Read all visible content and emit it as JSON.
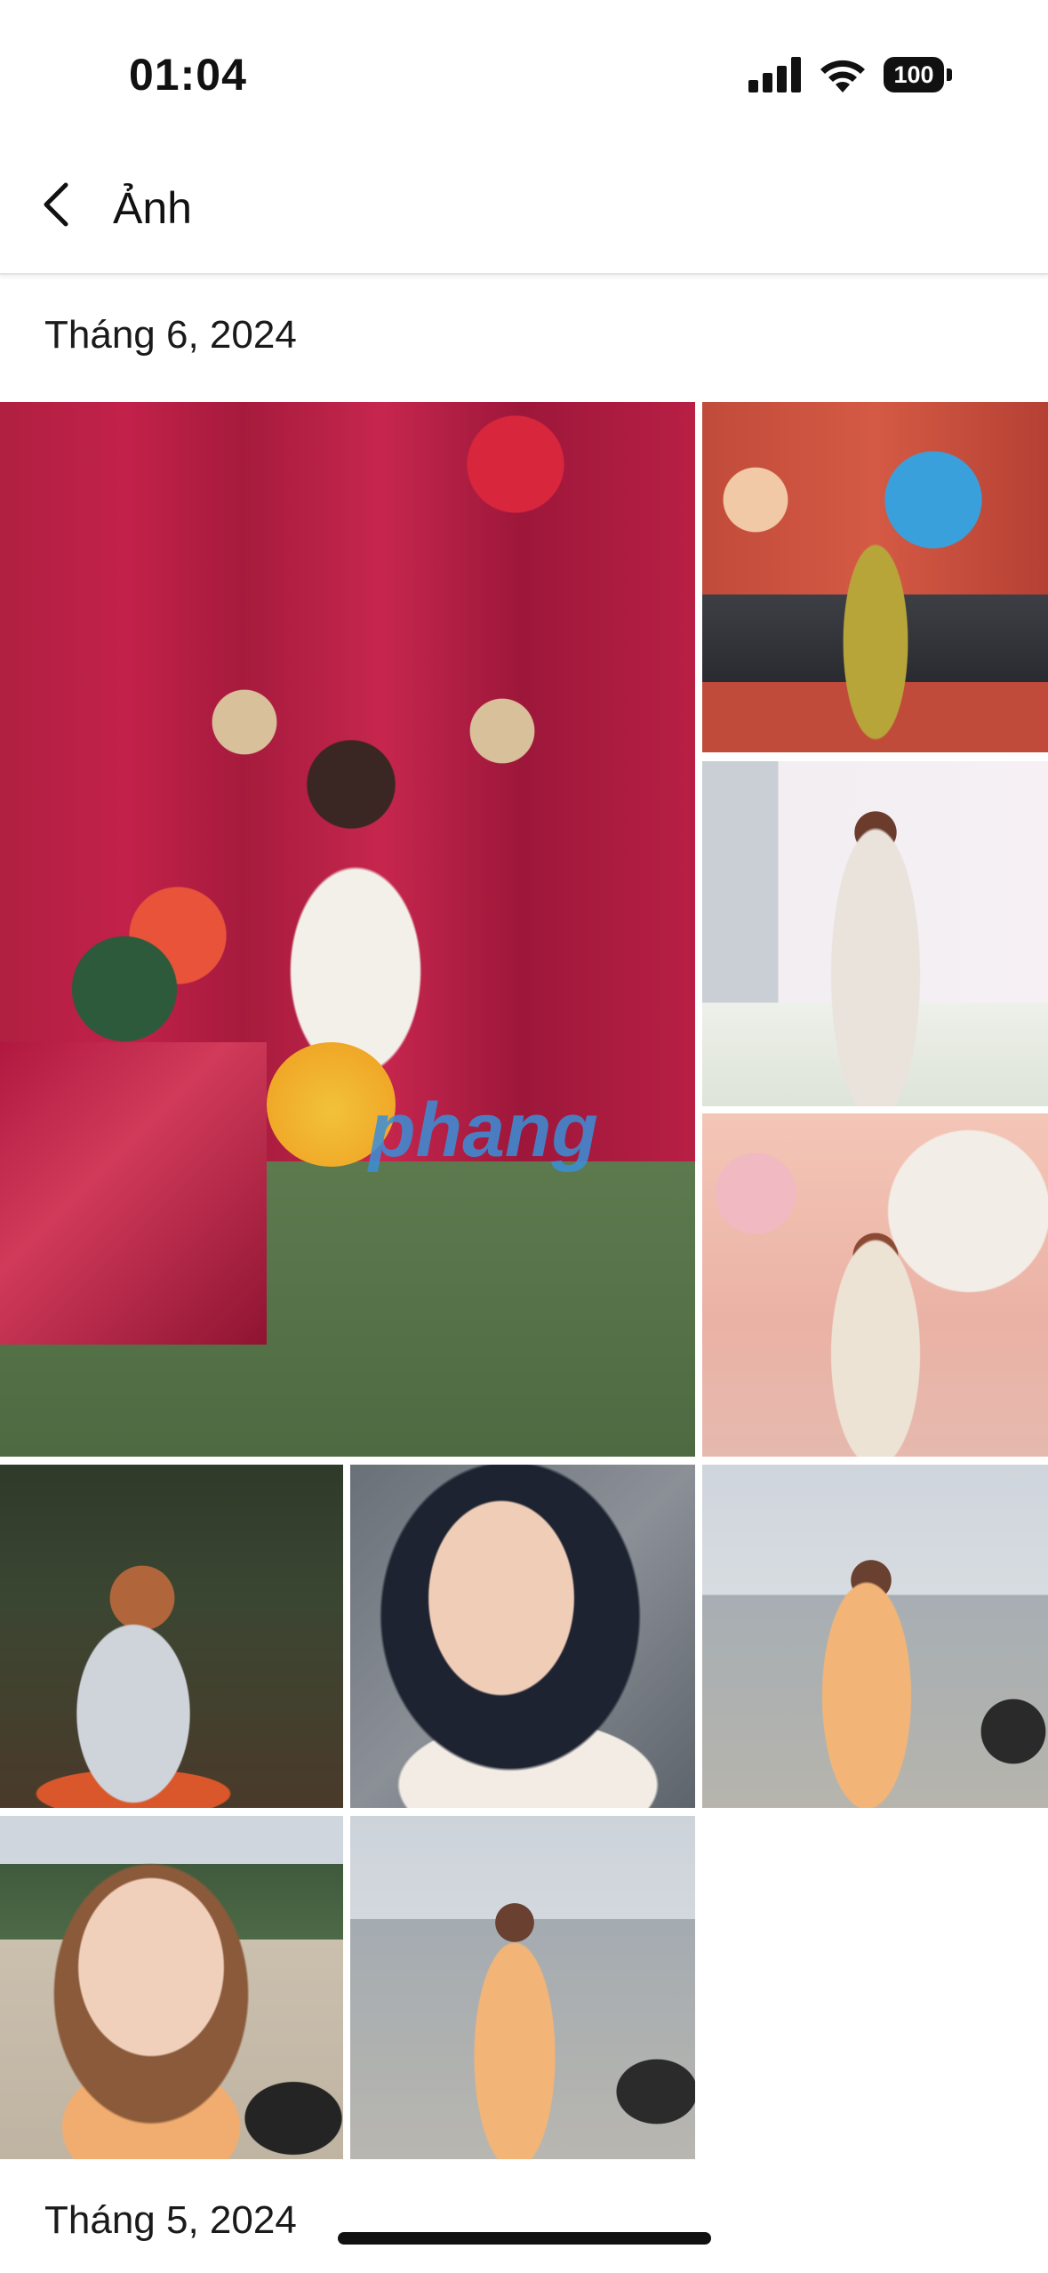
{
  "status": {
    "time": "01:04",
    "battery": "100"
  },
  "nav": {
    "title": "Ảnh"
  },
  "sections": [
    {
      "title": "Tháng 6, 2024"
    },
    {
      "title": "Tháng 5, 2024"
    }
  ],
  "photos": [
    {
      "name": "photo-large-tet-backdrop"
    },
    {
      "name": "photo-doraemon-mural"
    },
    {
      "name": "photo-white-flower-backdrop"
    },
    {
      "name": "photo-wedding-backdrop"
    },
    {
      "name": "photo-night-cafe"
    },
    {
      "name": "photo-closeup-portrait"
    },
    {
      "name": "photo-beach-1"
    },
    {
      "name": "photo-beach-trees"
    },
    {
      "name": "photo-beach-2"
    }
  ],
  "watermark": "phang"
}
